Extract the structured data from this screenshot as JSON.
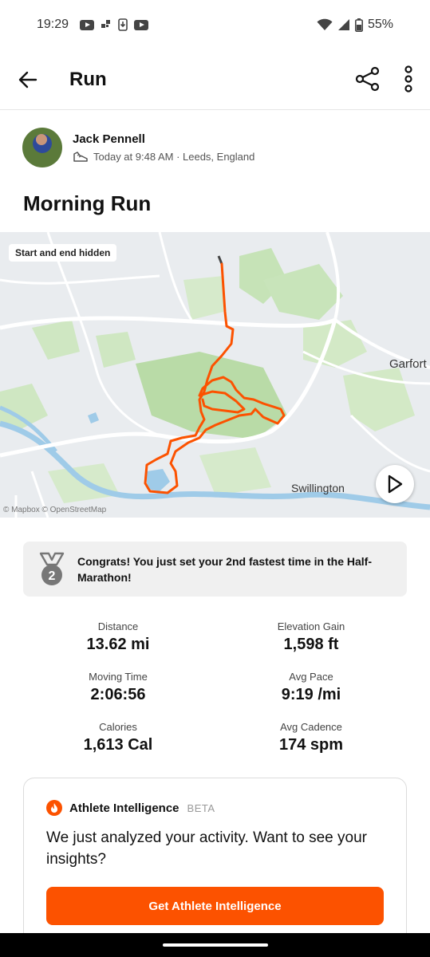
{
  "status_bar": {
    "time": "19:29",
    "battery": "55%",
    "icons": [
      "youtube-icon",
      "notification-icon",
      "download-icon",
      "youtube-icon",
      "wifi-icon",
      "signal-icon",
      "battery-icon"
    ]
  },
  "app_bar": {
    "title": "Run",
    "back_icon": "arrow-left-icon",
    "share_icon": "share-icon",
    "more_icon": "more-vertical-icon"
  },
  "athlete": {
    "name": "Jack Pennell",
    "meta": "Today at 9:48 AM · Leeds, England",
    "activity_icon": "shoe-icon"
  },
  "activity": {
    "title": "Morning Run"
  },
  "map": {
    "privacy_chip": "Start and end hidden",
    "labels": {
      "garforth": "Garfort",
      "swillington": "Swillington"
    },
    "attribution": "© Mapbox © OpenStreetMap",
    "route_color": "#fc5200",
    "play_icon": "play-icon"
  },
  "achievement": {
    "text": "Congrats! You just set your 2nd fastest time in the Half-Marathon!",
    "medal_number": "2",
    "icon": "medal-icon"
  },
  "stats": {
    "distance": {
      "label": "Distance",
      "value": "13.62 mi"
    },
    "elevation": {
      "label": "Elevation Gain",
      "value": "1,598 ft"
    },
    "moving_time": {
      "label": "Moving Time",
      "value": "2:06:56"
    },
    "avg_pace": {
      "label": "Avg Pace",
      "value": "9:19 /mi"
    },
    "calories": {
      "label": "Calories",
      "value": "1,613 Cal"
    },
    "avg_cadence": {
      "label": "Avg Cadence",
      "value": "174 spm"
    }
  },
  "athlete_intelligence": {
    "title": "Athlete Intelligence",
    "badge": "BETA",
    "body": "We just analyzed your activity. Want to see your insights?",
    "button_label": "Get Athlete Intelligence",
    "accent": "#fc5200"
  }
}
